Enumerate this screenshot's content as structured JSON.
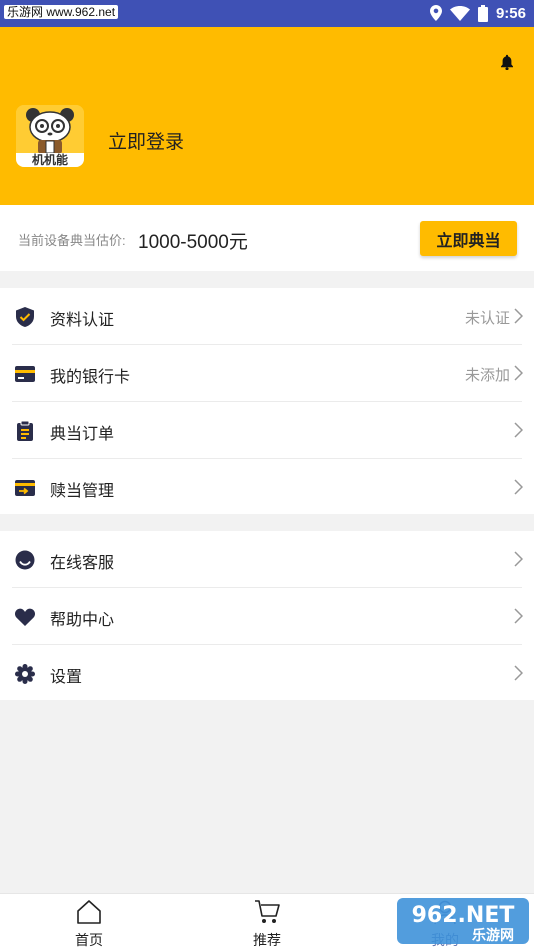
{
  "status_bar": {
    "watermark_text": "乐游网 www.962.net",
    "time": "9:56"
  },
  "header": {
    "login_label": "立即登录",
    "avatar_text": "机机能"
  },
  "estimate": {
    "label": "当前设备典当估价:",
    "value": "1000-5000元",
    "button_label": "立即典当"
  },
  "menu_group_1": [
    {
      "label": "资料认证",
      "status": "未认证",
      "icon": "shield-check-icon"
    },
    {
      "label": "我的银行卡",
      "status": "未添加",
      "icon": "credit-card-icon"
    },
    {
      "label": "典当订单",
      "status": "",
      "icon": "clipboard-icon"
    },
    {
      "label": "赎当管理",
      "status": "",
      "icon": "card-arrow-icon"
    }
  ],
  "menu_group_2": [
    {
      "label": "在线客服",
      "icon": "smile-icon"
    },
    {
      "label": "帮助中心",
      "icon": "heart-icon"
    },
    {
      "label": "设置",
      "icon": "gear-icon"
    }
  ],
  "tabbar": [
    {
      "label": "首页",
      "icon": "home-icon"
    },
    {
      "label": "推荐",
      "icon": "cart-icon"
    },
    {
      "label": "我的",
      "icon": "user-icon"
    }
  ],
  "watermark": {
    "text_top": "962.NET",
    "text_bottom": "乐游网"
  },
  "colors": {
    "accent": "#ffbb00",
    "status_bar": "#3f51b5",
    "icon": "#2a2d4a"
  }
}
